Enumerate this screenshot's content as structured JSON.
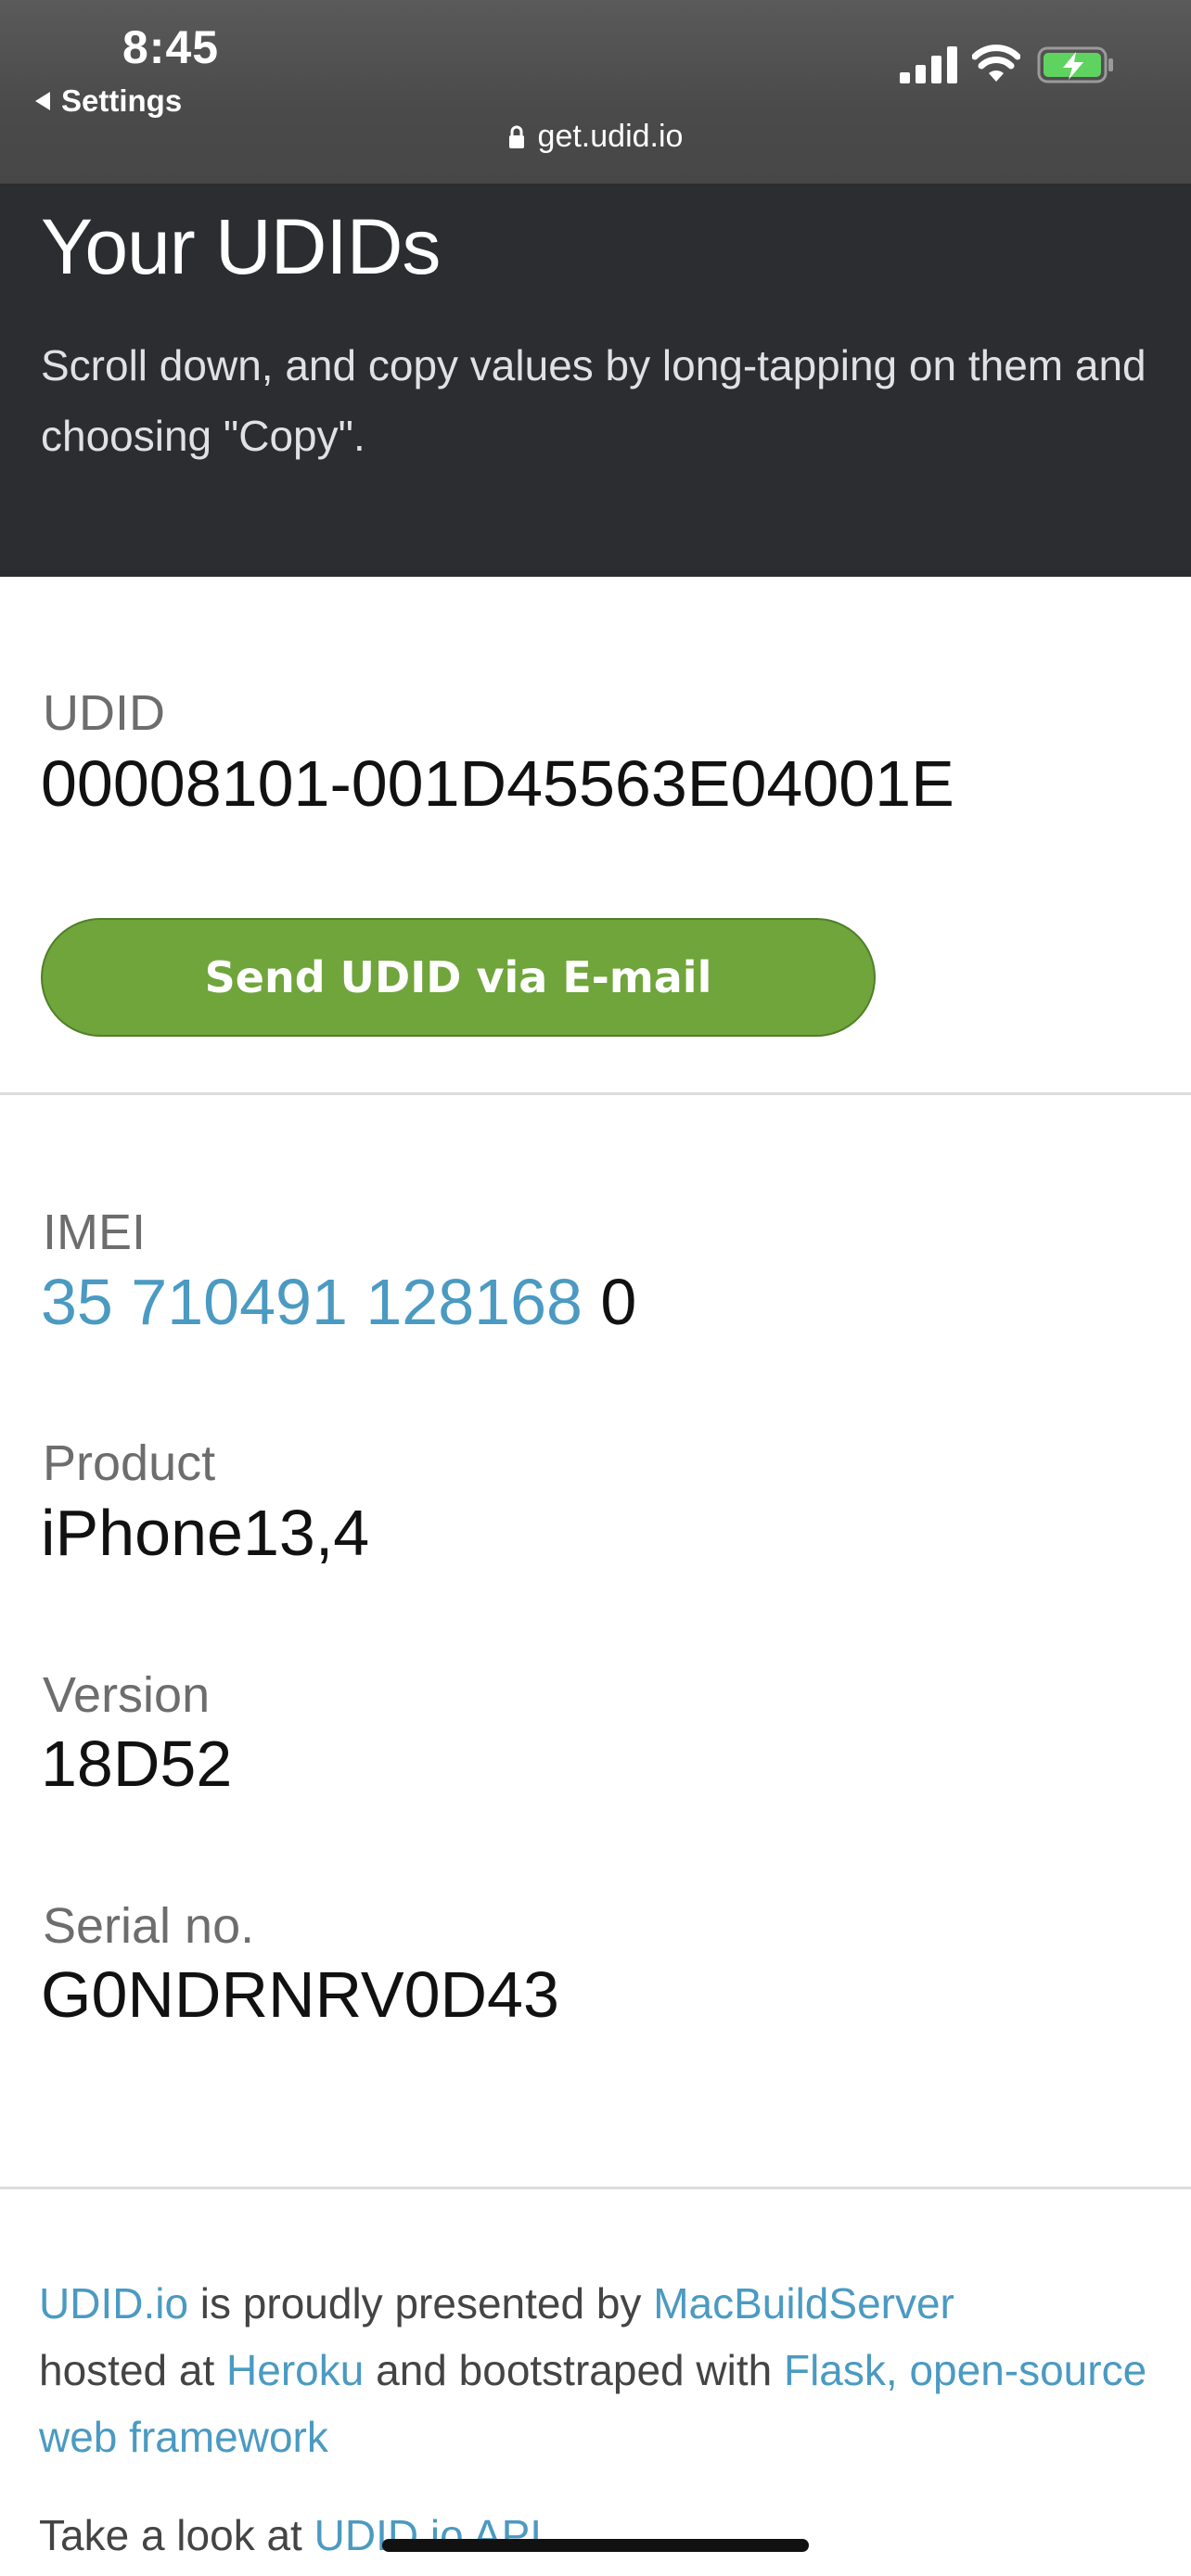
{
  "status_bar": {
    "time": "8:45",
    "back_label": "Settings",
    "url": "get.udid.io"
  },
  "header": {
    "title": "Your UDIDs",
    "subtitle": "Scroll down, and copy values by long-tapping on them and choosing \"Copy\"."
  },
  "udid": {
    "label": "UDID",
    "value": "00008101-001D45563E04001E",
    "send_button": "Send UDID via E-mail"
  },
  "fields": {
    "imei_label": "IMEI",
    "imei_link_part": "35 710491 128168",
    "imei_check_digit": "0",
    "product_label": "Product",
    "product_value": "iPhone13,4",
    "version_label": "Version",
    "version_value": "18D52",
    "serial_label": "Serial no.",
    "serial_value": "G0NDRNRV0D43"
  },
  "footer": {
    "udid_io_link": "UDID.io",
    "presented_text": " is proudly presented by ",
    "macbuildserver_link": "MacBuildServer",
    "hosted_text": "hosted at ",
    "heroku_link": "Heroku",
    "bootstraped_text": " and bootstraped with ",
    "flask_link": "Flask, open-source web framework",
    "api_text": "Take a look at ",
    "api_link": "UDID.io API"
  },
  "colors": {
    "header_bg": "#2b2d31",
    "button_green": "#6fa53b",
    "link_blue": "#4b9ac2",
    "battery_green": "#5fd35f"
  }
}
